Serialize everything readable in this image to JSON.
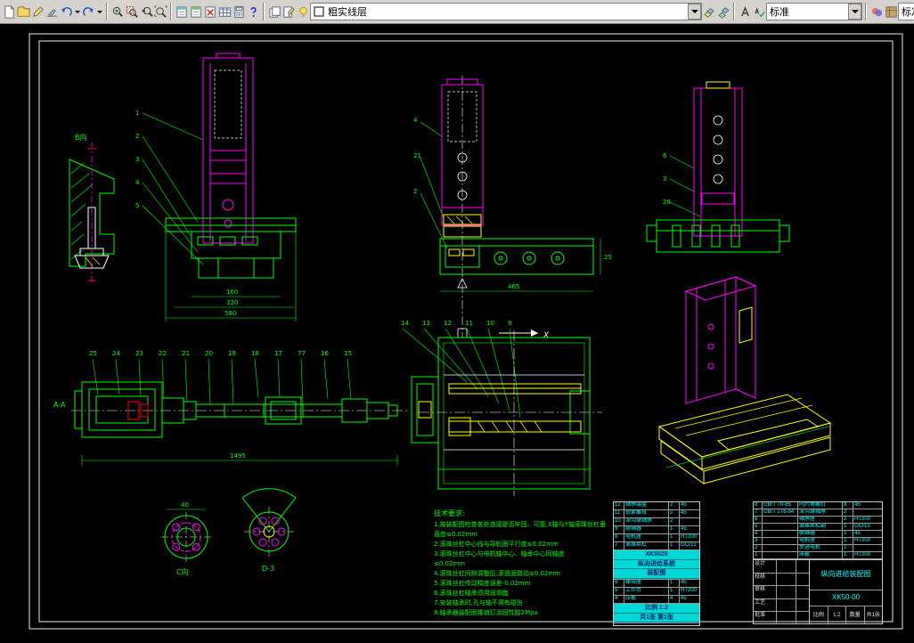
{
  "toolbar": {
    "layer_combo_value": "粗实线层",
    "style_combo_value": "标准",
    "clipped_combo_value": "标准",
    "icons": [
      "new-file",
      "open-file",
      "pencil",
      "brush",
      "undo",
      "redo",
      "zoom-realtime",
      "zoom-window",
      "zoom-previous",
      "zoom-extents",
      "sheet-cyan",
      "sheet-green",
      "plot-error",
      "table-grid",
      "calculator",
      "help",
      "sheet-stack",
      "sheet-edit",
      "bulb",
      "layer-swatch",
      "make-object-layer",
      "layer-translate",
      "text-style",
      "spell-check",
      "render",
      "materials"
    ]
  },
  "views": {
    "corner": {
      "label": "B向"
    },
    "front": {
      "callouts": [
        "1",
        "2",
        "3",
        "4",
        "5"
      ],
      "dims": [
        "160",
        "320",
        "580"
      ]
    },
    "center": {
      "callouts": [
        "4",
        "21",
        "2"
      ],
      "dims": [
        "25",
        "465"
      ],
      "axis_label": "X"
    },
    "side": {
      "callouts": [
        "6",
        "3",
        "28"
      ]
    },
    "shaft": {
      "section_label": "A-A",
      "callouts": [
        "25",
        "24",
        "23",
        "22",
        "21",
        "20",
        "19",
        "18",
        "17",
        "77",
        "16",
        "15"
      ],
      "dims": [
        "1495"
      ]
    },
    "plan": {
      "callouts": [
        "14",
        "13",
        "12",
        "11",
        "10",
        "9"
      ]
    },
    "detail_c": {
      "label": "C向",
      "dim": "40"
    },
    "detail_d": {
      "label": "D-3"
    }
  },
  "notes": {
    "title": "技术要求:",
    "lines": [
      "1.按装配图检查各处连接是否牢固、可靠,X轴与Y轴滚珠丝杠垂",
      "直度≤0.02mm",
      "2.滚珠丝杠中心线与导轨面平行度≤0.02mm",
      "3.滚珠丝杠中心与电机轴中心、轴承中心同轴度",
      "≤0.02mm",
      "4.滚珠丝杠间隙调整后,滚道面跳动≤0.02mm",
      "5.滚珠丝杠传动精度误差-0.02mm",
      "6.滚珠丝杠轴承须用润滑脂",
      "7.安装轴承时,孔与轴不得有碰伤",
      "8.轴承器装配面锥销钉涂固性胶2Mpa"
    ]
  },
  "bom_left": {
    "rows": [
      {
        "no": "12",
        "name": "轴承端盖",
        "qty": "2",
        "mat": "45"
      },
      {
        "no": "11",
        "name": "锁紧螺母",
        "qty": "2",
        "mat": "45"
      },
      {
        "no": "10",
        "name": "深沟球轴承",
        "qty": "2",
        "mat": ""
      },
      {
        "no": "9",
        "name": "联轴器",
        "qty": "1",
        "mat": "45"
      },
      {
        "no": "8",
        "name": "电机座",
        "qty": "1",
        "mat": "HT200"
      },
      {
        "no": "7",
        "name": "滚珠丝杠",
        "qty": "1",
        "mat": "GCr15"
      }
    ],
    "hl1": [
      "XK5025",
      "纵向进给系统",
      "装配图"
    ],
    "rows2": [
      {
        "no": "6",
        "name": "螺母座",
        "qty": "1",
        "mat": "45"
      },
      {
        "no": "5",
        "name": "工作台",
        "qty": "1",
        "mat": "HT200"
      },
      {
        "no": "4",
        "name": "压板",
        "qty": "4",
        "mat": "45"
      }
    ],
    "hl2": [
      "比例 1:2",
      "共1张 第1张"
    ]
  },
  "title_block": {
    "bom_rows": [
      {
        "no": "8",
        "code": "GB/T 70-85",
        "name": "内六角螺钉",
        "qty": "8",
        "mat": "45"
      },
      {
        "no": "7",
        "code": "GB/T 276-94",
        "name": "深沟球轴承",
        "qty": "2",
        "mat": ""
      },
      {
        "no": "6",
        "code": "",
        "name": "轴承座",
        "qty": "2",
        "mat": "HT200"
      },
      {
        "no": "5",
        "code": "",
        "name": "滚珠丝杠副",
        "qty": "1",
        "mat": "GCr15"
      },
      {
        "no": "4",
        "code": "",
        "name": "联轴器",
        "qty": "1",
        "mat": "45"
      },
      {
        "no": "3",
        "code": "",
        "name": "电机座",
        "qty": "1",
        "mat": "HT200"
      },
      {
        "no": "2",
        "code": "",
        "name": "步进电机",
        "qty": "1",
        "mat": ""
      },
      {
        "no": "1",
        "code": "",
        "name": "床鞍",
        "qty": "1",
        "mat": "HT200"
      }
    ],
    "fields": {
      "design": "设计",
      "check": "校核",
      "audit": "审核",
      "process": "工艺",
      "approve": "批准",
      "scale_label": "比例",
      "scale": "1:2",
      "qty_label": "数量",
      "sheet": "共1张",
      "title": "纵向进给装配图",
      "code": "XK50-00"
    }
  }
}
